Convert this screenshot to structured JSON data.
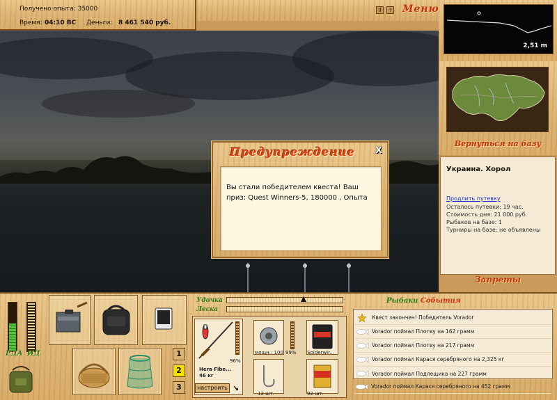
{
  "stats": {
    "xp_label": "Получено опыта: 35000",
    "time_label": "Время:",
    "time_value": "04:10 ВС",
    "money_label": "Деньги:",
    "money_value": "8 461 540 руб."
  },
  "toolbar": {
    "pause_label": "II",
    "help_label": "?",
    "menu_label": "Меню"
  },
  "depth": {
    "value": "2,51 m"
  },
  "base": {
    "return_label": "Вернуться на базу",
    "location": "Украина. Хорол",
    "extend_link": "Продлить путевку",
    "remaining": "Осталось путевки: 19 час.",
    "day_cost": "Стоимость дня: 21 000 руб.",
    "anglers": "Рыбаков на базе: 1",
    "tournaments": "Турниры на базе: не объявлены",
    "bans_label": "Запреты"
  },
  "dialog": {
    "title": "Предупреждение",
    "close": "X",
    "message": "Вы стали победителем квеста! Ваш приз: Quest Winners-5, 180000 , Опыта"
  },
  "meters": {
    "food_label": "ЕДА",
    "drink_label": "ИД",
    "food_level": 0.55,
    "drink_level": 0.0
  },
  "slots": {
    "buttons": [
      "1",
      "2",
      "3"
    ],
    "active": "2"
  },
  "rod_panel": {
    "rod_label": "Удочка",
    "line_label": "Леска",
    "rod_name": "Hera Fibe...",
    "rod_weight": "46 кг",
    "rod_pct": "96%",
    "reel_info": "мощн.: 100",
    "reel_pct": "99%",
    "line_name": "Spiderwir...",
    "hooks_count": "12 шт.",
    "bait_count": "92 шт.",
    "setup_button": "настроить"
  },
  "events": {
    "title_a": "Рыбаки",
    "title_b": "События",
    "items": [
      "Квест закончен! Победитель Vorador",
      "Vorador поймал Плотву на 162 грамм",
      "Vorador поймал Плотву на 217 грамм",
      "Vorador поймал Карася серебряного на 2,325 кг",
      "Vorador поймал Подлещика на 227 грамм",
      "Vorador поймал Карася серебряного на 452 грамм"
    ]
  }
}
